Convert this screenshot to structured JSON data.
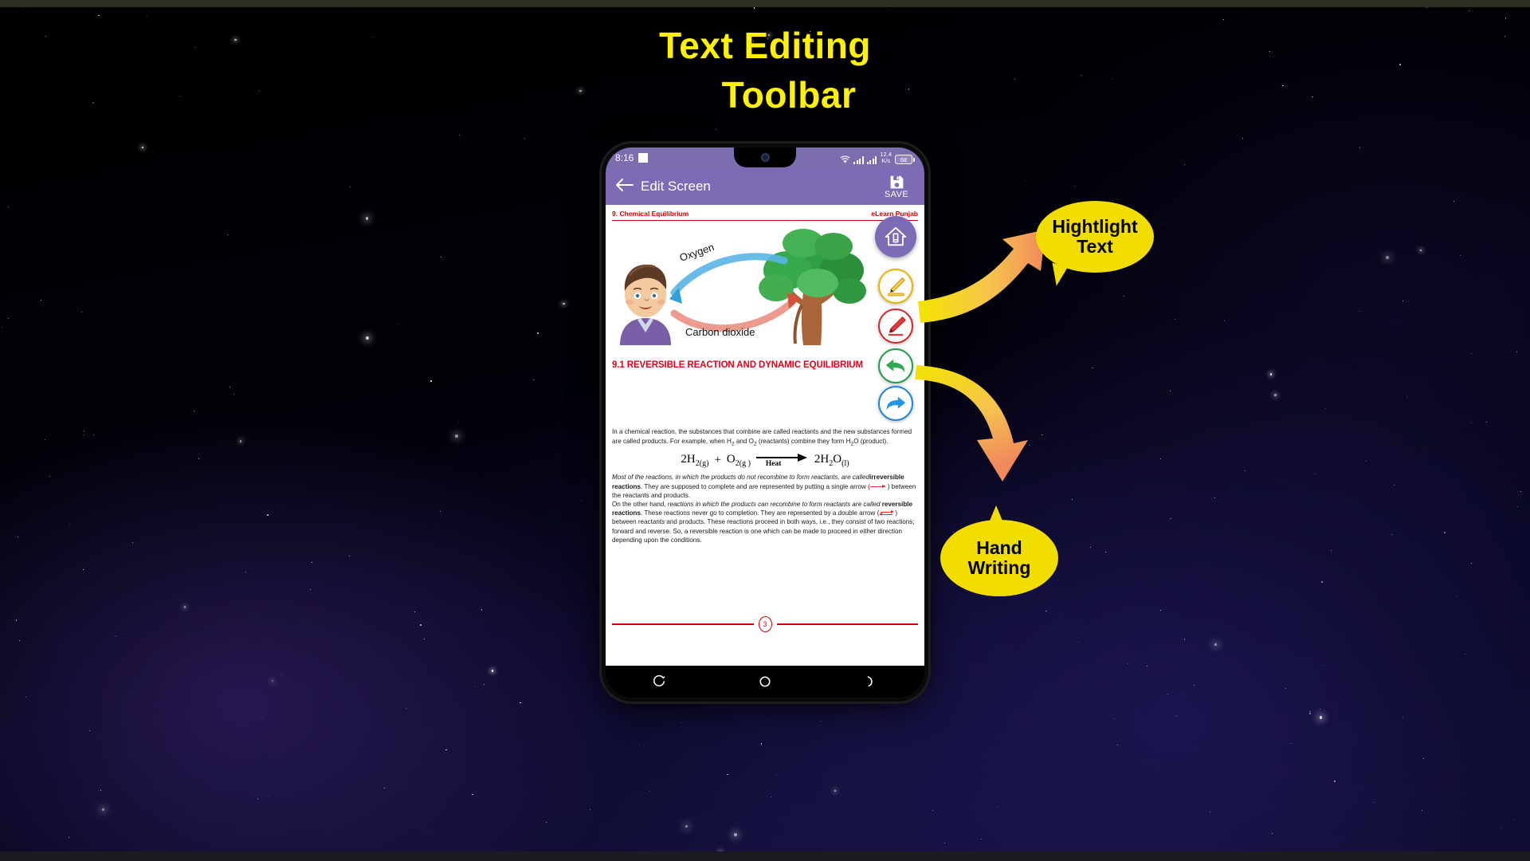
{
  "poster": {
    "title_line1": "Text Editing",
    "title_line2": "Toolbar",
    "title_color": "#FFF200",
    "background": "#000000"
  },
  "callouts": [
    {
      "id": "highlight",
      "line1": "Hightlight",
      "line2": "Text",
      "color": "#F2DD00"
    },
    {
      "id": "handwriting",
      "line1": "Hand",
      "line2": "Writing",
      "color": "#F2DD00"
    }
  ],
  "phone": {
    "status_bar": {
      "clock": "8:16",
      "network_speed": "12.4",
      "network_speed_unit": "K/s",
      "battery_percent": "68",
      "wifi_icon": "wifi-icon",
      "signal_icon": "signal-bars-icon"
    },
    "app_bar": {
      "back_icon": "back-arrow-icon",
      "title": "Edit Screen",
      "save_label": "SAVE",
      "save_icon": "floppy-disk-icon",
      "background": "#7e6bb5"
    },
    "navigation_bar": {
      "recents_icon": "recent-apps-icon",
      "home_icon": "home-circle-icon",
      "back_icon": "back-nav-icon"
    },
    "toolbar": {
      "fab": {
        "name": "edit-fab",
        "icon": "pencil-up-icon",
        "color": "#7e6bb5"
      },
      "buttons": [
        {
          "name": "highlighter-tool",
          "icon": "highlighter-pen-icon",
          "color": "#e8b400"
        },
        {
          "name": "pen-tool",
          "icon": "red-marker-icon",
          "color": "#d42a2a"
        },
        {
          "name": "undo-tool",
          "icon": "undo-arrow-icon",
          "color": "#1e9e4a"
        },
        {
          "name": "redo-tool",
          "icon": "redo-arrow-icon",
          "color": "#1a84d6"
        }
      ]
    },
    "document": {
      "chapter_title": "9. Chemical Equilibrium",
      "publisher": "eLearn Punjab",
      "rule_color": "#cc0000",
      "illustration": {
        "label_oxygen": "Oxygen",
        "label_co2": "Carbon dioxide",
        "description": "boy-and-tree-gas-exchange"
      },
      "section_heading": "9.1 REVERSIBLE REACTION AND DYNAMIC EQUILIBRIUM",
      "section_heading_color": "#e3001b",
      "paragraph_1": "In a chemical reaction, the substances that combine are called reactants and the new substances formed are called products. For example, when H",
      "paragraph_1_b": " and O",
      "paragraph_1_c": " (reactants) combine they form H",
      "paragraph_1_d": "O (product).",
      "equation": {
        "left_1": "2H",
        "left_1_sub": "2(g)",
        "plus": "+",
        "left_2": "O",
        "left_2_sub": "2(g )",
        "arrow_label": "Heat",
        "right": "2H",
        "right_sub1": "2",
        "right_mid": "O",
        "right_sub2": "(l)"
      },
      "paragraph_2_italic": "Most of the reactions, in which the products do not recombine to form reactants, are called",
      "paragraph_2_bold": "irreversible reactions",
      "paragraph_2_rest": ". They are supposed to complete and are represented by putting a single arrow (",
      "paragraph_2_tail": ") between the reactants and products.",
      "paragraph_3_lead": "On the other hand, ",
      "paragraph_3_italic": "reactions in which the products can recombine to form reactants are called",
      "paragraph_3_bold": "reversible reactions",
      "paragraph_3_rest": ". These reactions never go to completion. They are represented by a double arrow (",
      "paragraph_3_tail": ") between reactants and products. These reactions proceed in both ways, i.e., they consist of two reactions; forward and reverse.  So, a reversible reaction is one which can be made to proceed in either direction depending upon the conditions.",
      "page_number": "3"
    }
  }
}
